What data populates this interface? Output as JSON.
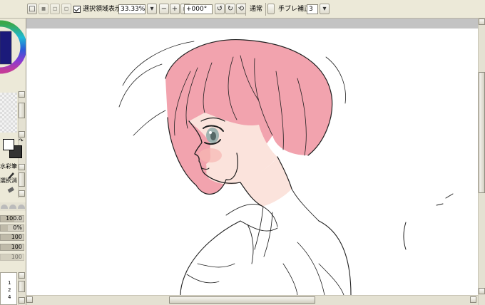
{
  "toolbar": {
    "show_selection_label": "選択領域表示",
    "zoom_value": "33.33%",
    "rotation_value": "+000°",
    "blend_mode": "通常",
    "stabilizer_label": "手ブレ補正",
    "stabilizer_value": "3"
  },
  "left_panel": {
    "brush_name": "水彩筆",
    "eraser_name": "選択消し",
    "sliders": [
      {
        "label": "",
        "value": "100.0"
      },
      {
        "label": "",
        "value": "0%"
      },
      {
        "label": "",
        "value": "100"
      },
      {
        "label": "",
        "value": "100"
      },
      {
        "label": "",
        "value": "100"
      }
    ],
    "list_numbers": [
      "1",
      "2",
      "4"
    ]
  },
  "colors": {
    "ui_face": "#ece9d8",
    "canvas_bg": "#c3c3c3",
    "paper": "#ffffff",
    "hair": "#f2a3ae",
    "skin": "#fbe3dc",
    "eye": "#9fb3b0",
    "line": "#1f1f1f"
  }
}
